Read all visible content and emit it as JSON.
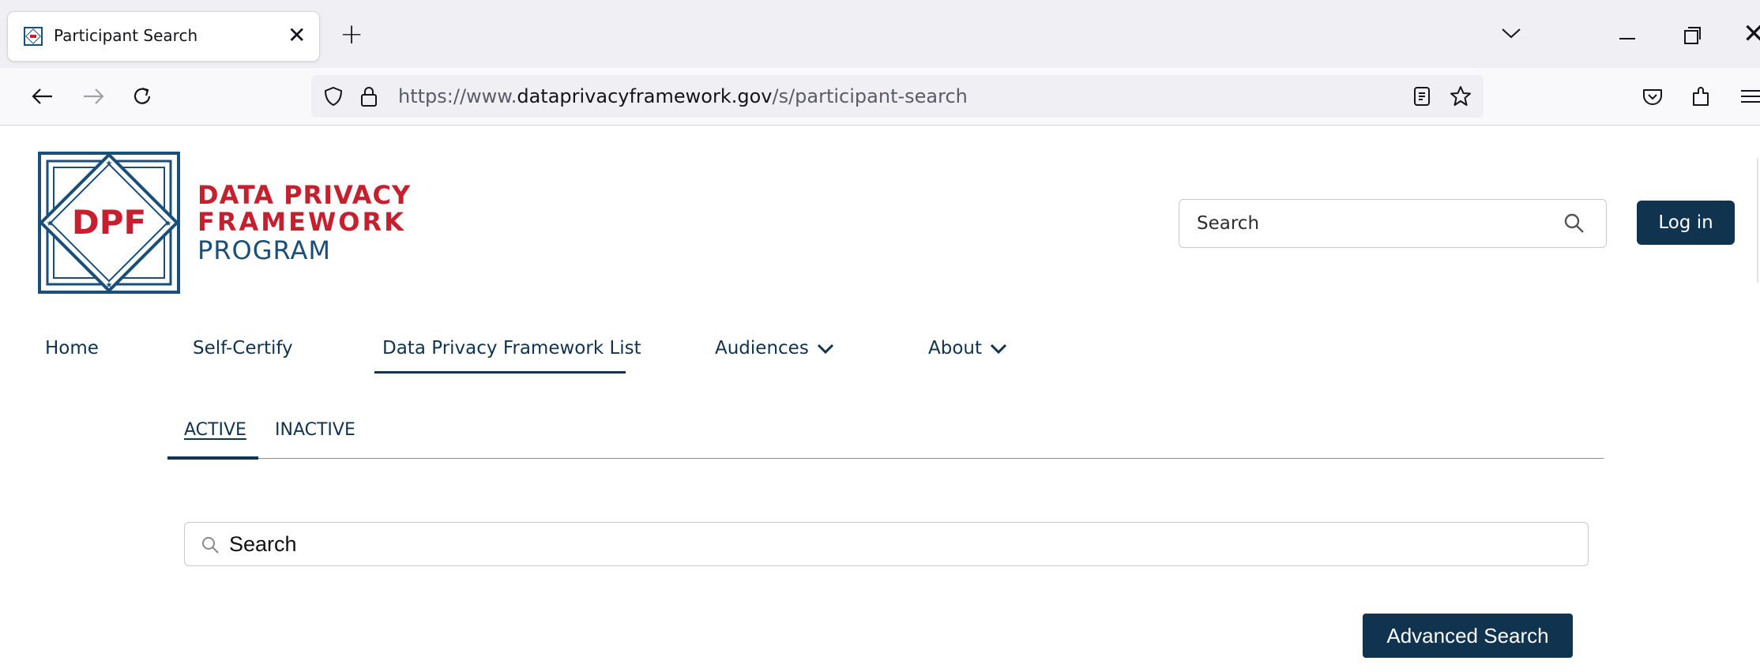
{
  "browser": {
    "tab_title": "Participant Search",
    "url_prefix": "https://www.",
    "url_domain": "dataprivacyframework.gov",
    "url_path": "/s/participant-search"
  },
  "site": {
    "brand_line1": "DATA PRIVACY",
    "brand_line2": "FRAMEWORK",
    "brand_line3": "PROGRAM",
    "logo_text": "DPF",
    "search_placeholder": "Search",
    "login_label": "Log in"
  },
  "main_nav": [
    {
      "label": "Home"
    },
    {
      "label": "Self-Certify"
    },
    {
      "label": "Data Privacy Framework List",
      "active": true
    },
    {
      "label": "Audiences",
      "has_dropdown": true
    },
    {
      "label": "About",
      "has_dropdown": true
    }
  ],
  "sub_tabs": [
    {
      "label": "ACTIVE",
      "active": true
    },
    {
      "label": "INACTIVE"
    }
  ],
  "participant_search": {
    "placeholder": "Search",
    "advanced_label": "Advanced Search"
  },
  "colors": {
    "brand_red": "#c6202e",
    "brand_blue": "#1a4f7a",
    "navy": "#10334f"
  }
}
